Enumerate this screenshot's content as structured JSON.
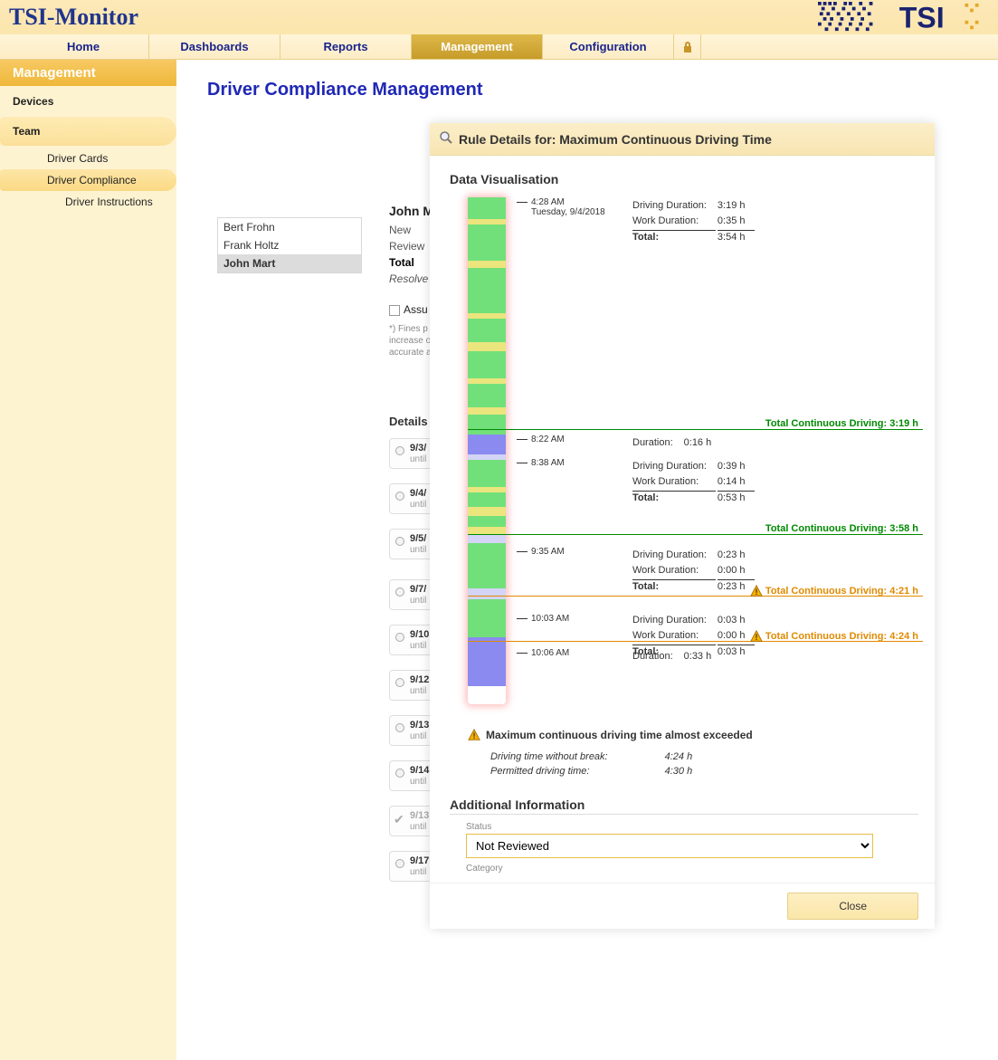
{
  "app_name": "TSI-Monitor",
  "nav": {
    "home": "Home",
    "dashboards": "Dashboards",
    "reports": "Reports",
    "management": "Management",
    "configuration": "Configuration"
  },
  "sidebar": {
    "header": "Management",
    "cat_devices": "Devices",
    "cat_team": "Team",
    "sub_driver_cards": "Driver Cards",
    "sub_driver_compliance": "Driver Compliance",
    "sub_driver_instructions": "Driver Instructions"
  },
  "page_title": "Driver Compliance Management",
  "drivers": {
    "d0": "Bert Frohn",
    "d1": "Frank Holtz",
    "d2": "John Mart"
  },
  "mid": {
    "name": "John M",
    "l1": "New",
    "l2": "Review",
    "l3": "Total",
    "l4": "Resolve",
    "l5": "Assu",
    "fine": "*) Fines p\nincrease o\naccurate a"
  },
  "details": {
    "header": "Details",
    "rows": {
      "r0": {
        "date": "9/3/",
        "until": "until"
      },
      "r1": {
        "date": "9/4/",
        "until": "until"
      },
      "r2": {
        "date": "9/5/",
        "until": "until"
      },
      "r3": {
        "date": "9/7/",
        "until": "until"
      },
      "r4": {
        "date": "9/10",
        "until": "until"
      },
      "r5": {
        "date": "9/12",
        "until": "until"
      },
      "r6": {
        "date": "9/13",
        "until": "until"
      },
      "r7": {
        "date": "9/14",
        "until": "until"
      },
      "r8": {
        "date": "9/13",
        "until": "until"
      },
      "r9": {
        "date": "9/17",
        "until": "until"
      }
    }
  },
  "dialog": {
    "title": "Rule Details for: Maximum Continuous Driving Time",
    "section_viz": "Data Visualisation",
    "section_addl": "Additional Information",
    "close": "Close",
    "status_label": "Status",
    "status_value": "Not Reviewed",
    "category_label": "Category",
    "warn": {
      "title": "Maximum continuous driving time almost exceeded",
      "row1_k": "Driving time without break:",
      "row1_v": "4:24 h",
      "row2_k": "Permitted driving time:",
      "row2_v": "4:30 h"
    },
    "tstamps": {
      "t0": {
        "time": "4:28 AM",
        "sub": "Tuesday, 9/4/2018"
      },
      "t1": {
        "time": "8:22 AM"
      },
      "t2": {
        "time": "8:38 AM"
      },
      "t3": {
        "time": "9:35 AM"
      },
      "t4": {
        "time": "10:03 AM"
      },
      "t5": {
        "time": "10:06 AM"
      }
    },
    "durations": {
      "b0": {
        "k1": "Driving Duration:",
        "v1": "3:19 h",
        "k2": "Work Duration:",
        "v2": "0:35 h",
        "kt": "Total:",
        "vt": "3:54 h"
      },
      "b1": {
        "k1": "Duration:",
        "v1": "0:16 h"
      },
      "b2": {
        "k1": "Driving Duration:",
        "v1": "0:39 h",
        "k2": "Work Duration:",
        "v2": "0:14 h",
        "kt": "Total:",
        "vt": "0:53 h"
      },
      "b3": {
        "k1": "Driving Duration:",
        "v1": "0:23 h",
        "k2": "Work Duration:",
        "v2": "0:00 h",
        "kt": "Total:",
        "vt": "0:23 h"
      },
      "b4": {
        "k1": "Driving Duration:",
        "v1": "0:03 h",
        "k2": "Work Duration:",
        "v2": "0:00 h",
        "kt": "Total:",
        "vt": "0:03 h"
      },
      "b5": {
        "k1": "Duration:",
        "v1": "0:33 h"
      }
    },
    "tcd": {
      "g1": "Total Continuous Driving:   3:19 h",
      "g2": "Total Continuous Driving:   3:58 h",
      "o1": "Total Continuous Driving:   4:21 h",
      "o2": "Total Continuous Driving:   4:24 h"
    }
  }
}
